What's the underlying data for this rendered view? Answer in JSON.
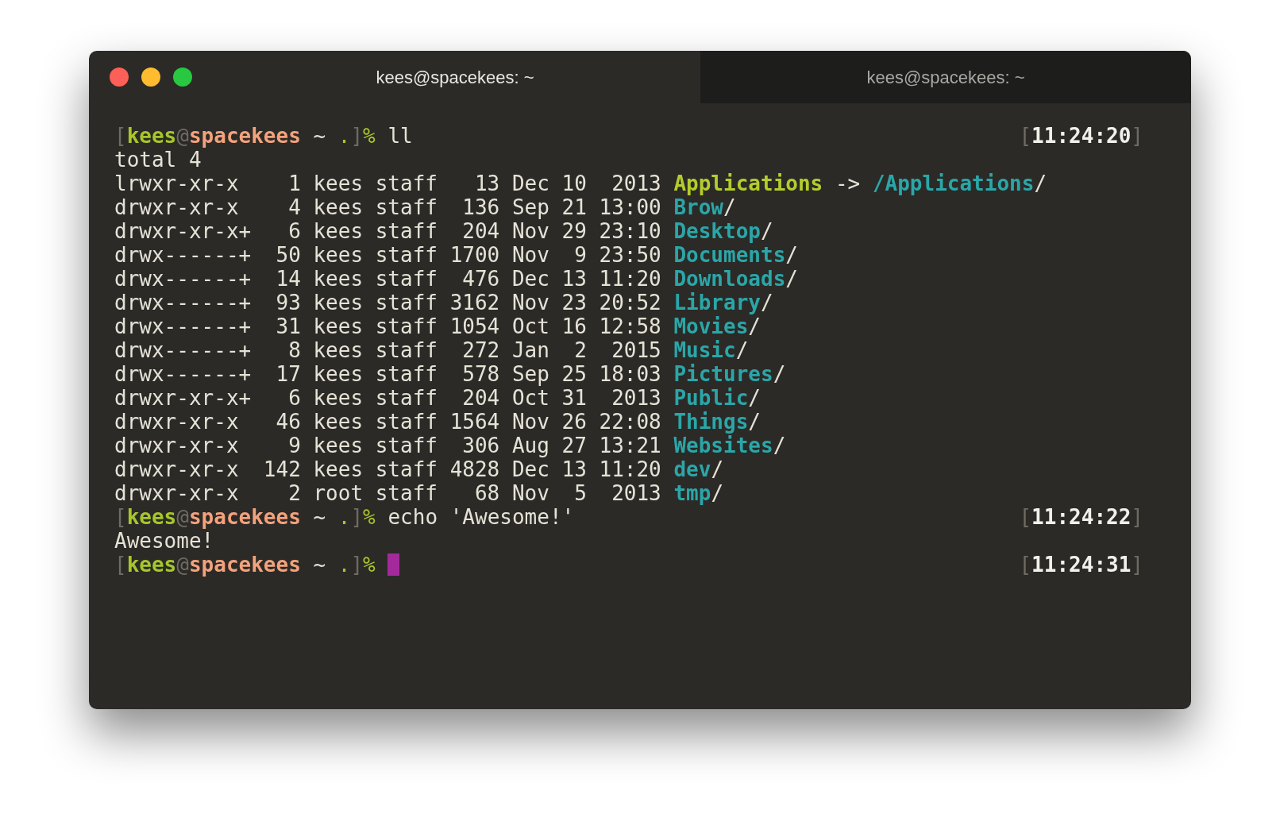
{
  "tabs": [
    {
      "title": "kees@spacekees: ~",
      "selected": true
    },
    {
      "title": "kees@spacekees: ~",
      "selected": false
    }
  ],
  "lines": [
    {
      "segments": [
        {
          "text": "[",
          "kind": "dim"
        },
        {
          "text": "kees",
          "kind": "user"
        },
        {
          "text": "@",
          "kind": "dim"
        },
        {
          "text": "spacekees",
          "kind": "host"
        },
        {
          "text": " ~ ",
          "kind": "plain"
        },
        {
          "text": ".",
          "kind": "flag"
        },
        {
          "text": "]",
          "kind": "dim"
        },
        {
          "text": "% ",
          "kind": "flag"
        },
        {
          "text": "ll",
          "kind": "plain"
        }
      ],
      "time": [
        {
          "text": "[",
          "kind": "dim"
        },
        {
          "text": "11:24:20",
          "kind": "time"
        },
        {
          "text": "]",
          "kind": "dim"
        }
      ]
    },
    {
      "segments": [
        {
          "text": "total 4",
          "kind": "plain"
        }
      ]
    },
    {
      "segments": [
        {
          "text": "lrwxr-xr-x    1 kees staff   13 Dec 10  2013 ",
          "kind": "plain"
        },
        {
          "text": "Applications",
          "kind": "link"
        },
        {
          "text": " -> ",
          "kind": "plain"
        },
        {
          "text": "/Applications",
          "kind": "dir"
        },
        {
          "text": "/",
          "kind": "plain"
        }
      ]
    },
    {
      "segments": [
        {
          "text": "drwxr-xr-x    4 kees staff  136 Sep 21 13:00 ",
          "kind": "plain"
        },
        {
          "text": "Brow",
          "kind": "dir"
        },
        {
          "text": "/",
          "kind": "plain"
        }
      ]
    },
    {
      "segments": [
        {
          "text": "drwxr-xr-x+   6 kees staff  204 Nov 29 23:10 ",
          "kind": "plain"
        },
        {
          "text": "Desktop",
          "kind": "dir"
        },
        {
          "text": "/",
          "kind": "plain"
        }
      ]
    },
    {
      "segments": [
        {
          "text": "drwx------+  50 kees staff 1700 Nov  9 23:50 ",
          "kind": "plain"
        },
        {
          "text": "Documents",
          "kind": "dir"
        },
        {
          "text": "/",
          "kind": "plain"
        }
      ]
    },
    {
      "segments": [
        {
          "text": "drwx------+  14 kees staff  476 Dec 13 11:20 ",
          "kind": "plain"
        },
        {
          "text": "Downloads",
          "kind": "dir"
        },
        {
          "text": "/",
          "kind": "plain"
        }
      ]
    },
    {
      "segments": [
        {
          "text": "drwx------+  93 kees staff 3162 Nov 23 20:52 ",
          "kind": "plain"
        },
        {
          "text": "Library",
          "kind": "dir"
        },
        {
          "text": "/",
          "kind": "plain"
        }
      ]
    },
    {
      "segments": [
        {
          "text": "drwx------+  31 kees staff 1054 Oct 16 12:58 ",
          "kind": "plain"
        },
        {
          "text": "Movies",
          "kind": "dir"
        },
        {
          "text": "/",
          "kind": "plain"
        }
      ]
    },
    {
      "segments": [
        {
          "text": "drwx------+   8 kees staff  272 Jan  2  2015 ",
          "kind": "plain"
        },
        {
          "text": "Music",
          "kind": "dir"
        },
        {
          "text": "/",
          "kind": "plain"
        }
      ]
    },
    {
      "segments": [
        {
          "text": "drwx------+  17 kees staff  578 Sep 25 18:03 ",
          "kind": "plain"
        },
        {
          "text": "Pictures",
          "kind": "dir"
        },
        {
          "text": "/",
          "kind": "plain"
        }
      ]
    },
    {
      "segments": [
        {
          "text": "drwxr-xr-x+   6 kees staff  204 Oct 31  2013 ",
          "kind": "plain"
        },
        {
          "text": "Public",
          "kind": "dir"
        },
        {
          "text": "/",
          "kind": "plain"
        }
      ]
    },
    {
      "segments": [
        {
          "text": "drwxr-xr-x   46 kees staff 1564 Nov 26 22:08 ",
          "kind": "plain"
        },
        {
          "text": "Things",
          "kind": "dir"
        },
        {
          "text": "/",
          "kind": "plain"
        }
      ]
    },
    {
      "segments": [
        {
          "text": "drwxr-xr-x    9 kees staff  306 Aug 27 13:21 ",
          "kind": "plain"
        },
        {
          "text": "Websites",
          "kind": "dir"
        },
        {
          "text": "/",
          "kind": "plain"
        }
      ]
    },
    {
      "segments": [
        {
          "text": "drwxr-xr-x  142 kees staff 4828 Dec 13 11:20 ",
          "kind": "plain"
        },
        {
          "text": "dev",
          "kind": "dir"
        },
        {
          "text": "/",
          "kind": "plain"
        }
      ]
    },
    {
      "segments": [
        {
          "text": "drwxr-xr-x    2 root staff   68 Nov  5  2013 ",
          "kind": "plain"
        },
        {
          "text": "tmp",
          "kind": "dir"
        },
        {
          "text": "/",
          "kind": "plain"
        }
      ]
    },
    {
      "segments": [
        {
          "text": "[",
          "kind": "dim"
        },
        {
          "text": "kees",
          "kind": "user"
        },
        {
          "text": "@",
          "kind": "dim"
        },
        {
          "text": "spacekees",
          "kind": "host"
        },
        {
          "text": " ~ ",
          "kind": "plain"
        },
        {
          "text": ".",
          "kind": "flag"
        },
        {
          "text": "]",
          "kind": "dim"
        },
        {
          "text": "% ",
          "kind": "flag"
        },
        {
          "text": "echo 'Awesome!'",
          "kind": "plain"
        }
      ],
      "time": [
        {
          "text": "[",
          "kind": "dim"
        },
        {
          "text": "11:24:22",
          "kind": "time"
        },
        {
          "text": "]",
          "kind": "dim"
        }
      ]
    },
    {
      "segments": [
        {
          "text": "Awesome!",
          "kind": "plain"
        }
      ]
    },
    {
      "segments": [
        {
          "text": "[",
          "kind": "dim"
        },
        {
          "text": "kees",
          "kind": "user"
        },
        {
          "text": "@",
          "kind": "dim"
        },
        {
          "text": "spacekees",
          "kind": "host"
        },
        {
          "text": " ~ ",
          "kind": "plain"
        },
        {
          "text": ".",
          "kind": "flag"
        },
        {
          "text": "]",
          "kind": "dim"
        },
        {
          "text": "% ",
          "kind": "flag"
        }
      ],
      "cursor": true,
      "time": [
        {
          "text": "[",
          "kind": "dim"
        },
        {
          "text": "11:24:31",
          "kind": "time"
        },
        {
          "text": "]",
          "kind": "dim"
        }
      ]
    }
  ]
}
